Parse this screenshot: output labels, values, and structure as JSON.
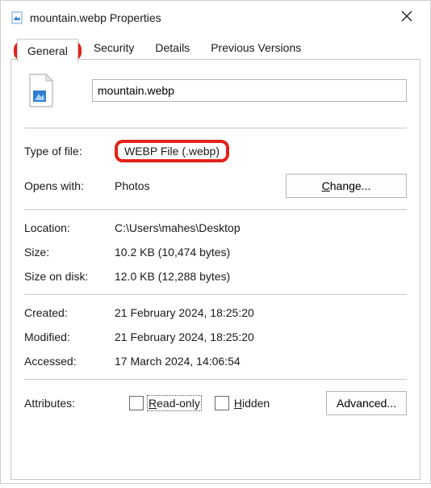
{
  "window": {
    "title": "mountain.webp Properties"
  },
  "tabs": {
    "general": "General",
    "security": "Security",
    "details": "Details",
    "previous": "Previous Versions"
  },
  "file": {
    "name": "mountain.webp"
  },
  "typeOfFile": {
    "label": "Type of file:",
    "value": "WEBP File (.webp)"
  },
  "opensWith": {
    "label": "Opens with:",
    "value": "Photos",
    "changePrefix": "C",
    "changeRest": "hange..."
  },
  "location": {
    "label": "Location:",
    "value": "C:\\Users\\mahes\\Desktop"
  },
  "size": {
    "label": "Size:",
    "value": "10.2 KB (10,474 bytes)"
  },
  "sizeOnDisk": {
    "label": "Size on disk:",
    "value": "12.0 KB (12,288 bytes)"
  },
  "created": {
    "label": "Created:",
    "value": "21 February 2024, 18:25:20"
  },
  "modified": {
    "label": "Modified:",
    "value": "21 February 2024, 18:25:20"
  },
  "accessed": {
    "label": "Accessed:",
    "value": "17 March 2024, 14:06:54"
  },
  "attributes": {
    "label": "Attributes:",
    "readonlyUnder": "R",
    "readonlyRest": "ead-only",
    "hiddenUnder": "H",
    "hiddenRest": "idden",
    "advanced": "Advanced..."
  }
}
